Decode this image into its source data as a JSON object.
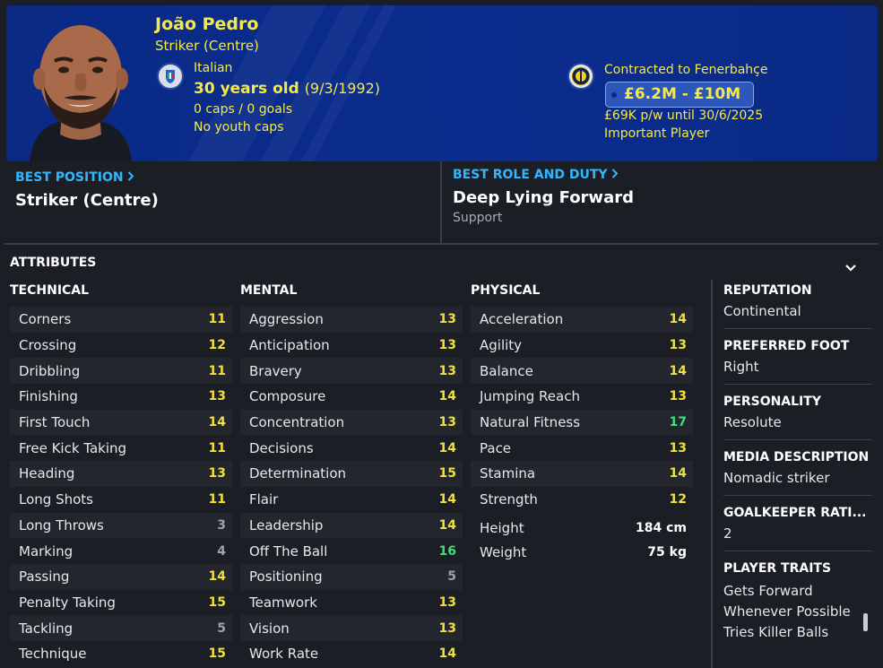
{
  "player": {
    "name": "João Pedro",
    "position": "Striker (Centre)",
    "nationality": "Italian",
    "age": "30 years old",
    "dob": "(9/3/1992)",
    "caps": "0 caps / 0 goals",
    "youth_caps": "No youth caps"
  },
  "contract": {
    "club_line": "Contracted to Fenerbahçe",
    "value": "£6.2M - £10M",
    "wage": "£69K p/w until 30/6/2025",
    "status": "Important Player"
  },
  "best_position": {
    "label": "BEST POSITION",
    "value": "Striker (Centre)"
  },
  "best_role": {
    "label": "BEST ROLE AND DUTY",
    "value": "Deep Lying Forward",
    "duty": "Support"
  },
  "attributes_title": "ATTRIBUTES",
  "technical": {
    "title": "TECHNICAL",
    "items": [
      {
        "name": "Corners",
        "value": "11"
      },
      {
        "name": "Crossing",
        "value": "12"
      },
      {
        "name": "Dribbling",
        "value": "11"
      },
      {
        "name": "Finishing",
        "value": "13"
      },
      {
        "name": "First Touch",
        "value": "14"
      },
      {
        "name": "Free Kick Taking",
        "value": "11"
      },
      {
        "name": "Heading",
        "value": "13"
      },
      {
        "name": "Long Shots",
        "value": "11"
      },
      {
        "name": "Long Throws",
        "value": "3"
      },
      {
        "name": "Marking",
        "value": "4"
      },
      {
        "name": "Passing",
        "value": "14"
      },
      {
        "name": "Penalty Taking",
        "value": "15"
      },
      {
        "name": "Tackling",
        "value": "5"
      },
      {
        "name": "Technique",
        "value": "15"
      }
    ]
  },
  "mental": {
    "title": "MENTAL",
    "items": [
      {
        "name": "Aggression",
        "value": "13"
      },
      {
        "name": "Anticipation",
        "value": "13"
      },
      {
        "name": "Bravery",
        "value": "13"
      },
      {
        "name": "Composure",
        "value": "14"
      },
      {
        "name": "Concentration",
        "value": "13"
      },
      {
        "name": "Decisions",
        "value": "14"
      },
      {
        "name": "Determination",
        "value": "15"
      },
      {
        "name": "Flair",
        "value": "14"
      },
      {
        "name": "Leadership",
        "value": "14"
      },
      {
        "name": "Off The Ball",
        "value": "16"
      },
      {
        "name": "Positioning",
        "value": "5"
      },
      {
        "name": "Teamwork",
        "value": "13"
      },
      {
        "name": "Vision",
        "value": "13"
      },
      {
        "name": "Work Rate",
        "value": "14"
      }
    ]
  },
  "physical": {
    "title": "PHYSICAL",
    "items": [
      {
        "name": "Acceleration",
        "value": "14"
      },
      {
        "name": "Agility",
        "value": "13"
      },
      {
        "name": "Balance",
        "value": "14"
      },
      {
        "name": "Jumping Reach",
        "value": "13"
      },
      {
        "name": "Natural Fitness",
        "value": "17"
      },
      {
        "name": "Pace",
        "value": "13"
      },
      {
        "name": "Stamina",
        "value": "14"
      },
      {
        "name": "Strength",
        "value": "12"
      }
    ],
    "height_label": "Height",
    "height": "184 cm",
    "weight_label": "Weight",
    "weight": "75 kg"
  },
  "side": {
    "reputation_label": "REPUTATION",
    "reputation": "Continental",
    "foot_label": "PREFERRED FOOT",
    "foot": "Right",
    "personality_label": "PERSONALITY",
    "personality": "Resolute",
    "media_label": "MEDIA DESCRIPTION",
    "media": "Nomadic striker",
    "gk_label": "GOALKEEPER RATI...",
    "gk": "2",
    "traits_label": "PLAYER TRAITS",
    "traits": [
      "Gets Forward",
      "Whenever Possible",
      "Tries Killer Balls"
    ]
  },
  "colors": {
    "header_bg": "#0a2a86",
    "accent_text": "#f5e94a",
    "link": "#32b7ff",
    "high_value": "#3be07a"
  },
  "icons": [
    "italy-flag-icon",
    "fenerbahce-badge-icon",
    "chevron-right-icon",
    "chevron-down-icon"
  ]
}
